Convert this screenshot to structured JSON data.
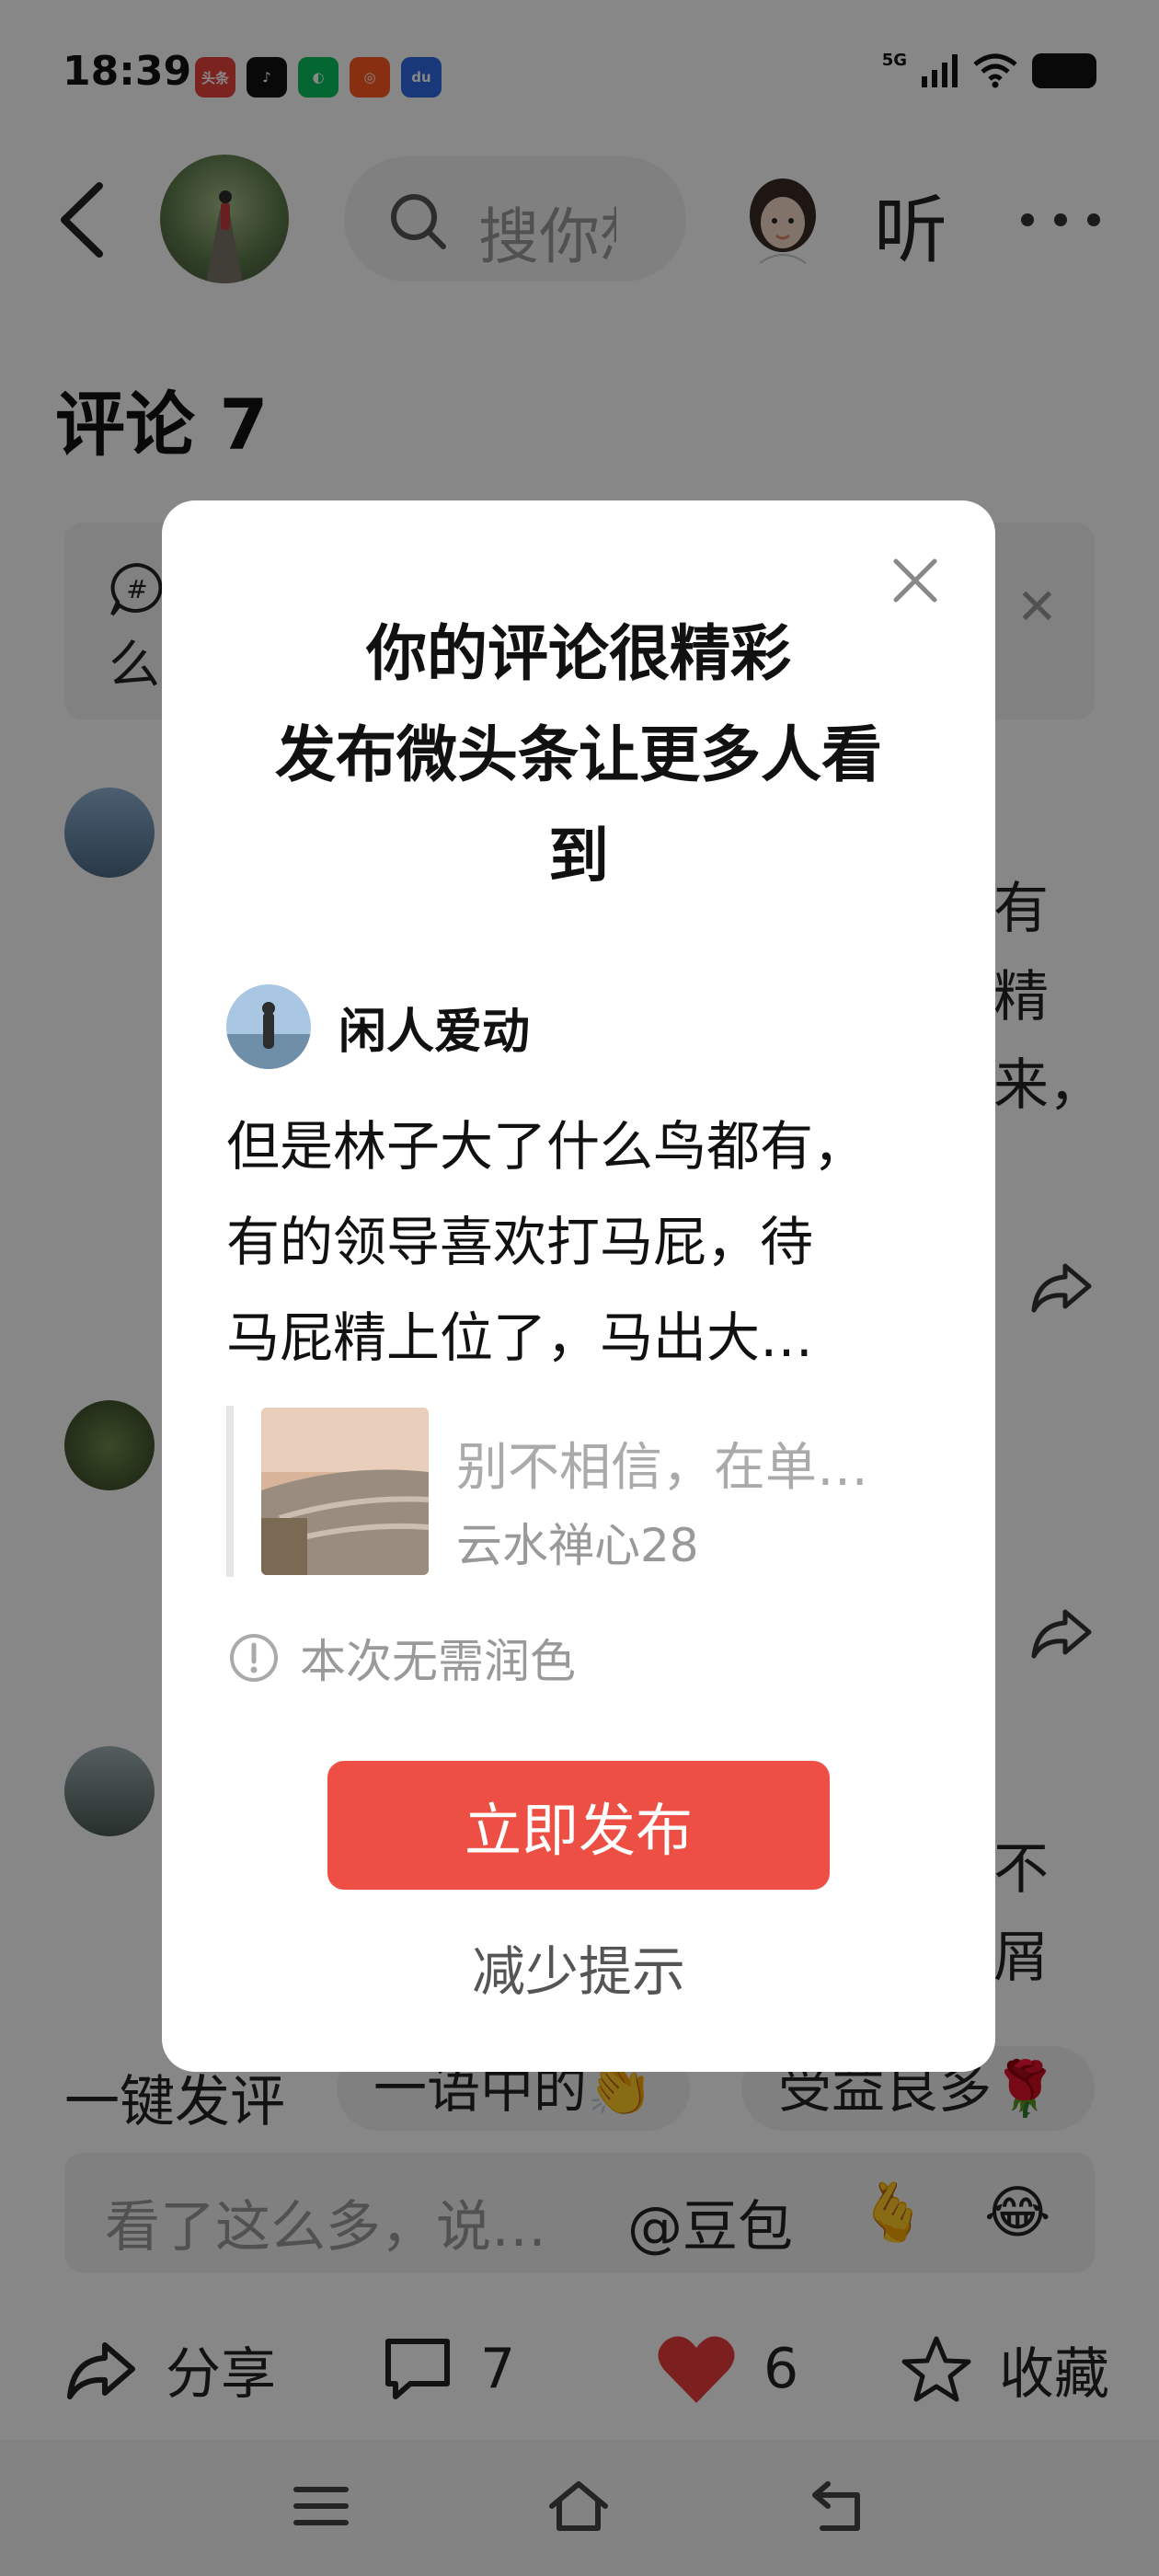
{
  "status_bar": {
    "time": "18:39",
    "network": "5G",
    "apps": [
      {
        "name": "toutiao",
        "label": "头条",
        "color": "#e8433a"
      },
      {
        "name": "douyin",
        "label": "♪",
        "color": "#111111"
      },
      {
        "name": "wechat",
        "label": "◐",
        "color": "#07c160"
      },
      {
        "name": "kuaishou",
        "label": "◎",
        "color": "#ff5a1f"
      },
      {
        "name": "baidu",
        "label": "du",
        "color": "#2e6be6"
      }
    ]
  },
  "header": {
    "search_placeholder": "搜你想",
    "listen_label": "听"
  },
  "page": {
    "comments_title": "评论 7",
    "topic_text": "么",
    "side_fragments": {
      "first": [
        "有",
        "精",
        "来，"
      ],
      "second": [
        "不",
        "屑"
      ]
    }
  },
  "quick_replies": {
    "label": "一键发评",
    "chips": [
      "一语中的👏",
      "受益良多🌹"
    ]
  },
  "input_bar": {
    "placeholder": "看了这么多，说…",
    "mention": "@豆包",
    "emoji_1": "🫰",
    "emoji_2": "😂"
  },
  "actions": {
    "share_label": "分享",
    "comment_count": "7",
    "like_count": "6",
    "favorite_label": "收藏"
  },
  "modal": {
    "title_lines": [
      "你的评论很精彩",
      "发布微头条让更多人看",
      "到"
    ],
    "author_name": "闲人爱动",
    "comment_lines": [
      "但是林子大了什么鸟都有，",
      "有的领导喜欢打马屁，待",
      "马屁精上位了，马出大…"
    ],
    "quote_text": "别不相信，在单…",
    "quote_author": "云水禅心28",
    "polish_note": "本次无需润色",
    "publish_button": "立即发布",
    "reduce_link": "减少提示"
  },
  "colors": {
    "accent": "#ee4f45",
    "overlay": "rgba(0,0,0,0.47)",
    "like": "#e83b3b"
  }
}
